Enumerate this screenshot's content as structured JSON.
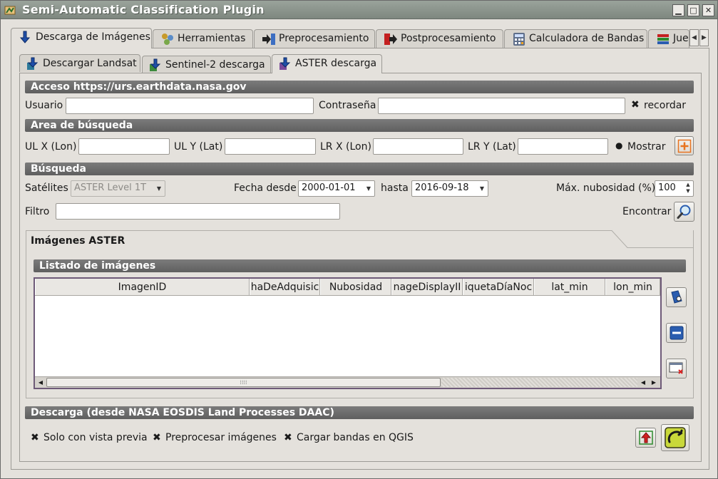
{
  "window": {
    "title": "Semi-Automatic Classification Plugin"
  },
  "main_tabs": [
    {
      "label": "Descarga de Imágenes",
      "icon": "download-arrow-icon"
    },
    {
      "label": "Herramientas",
      "icon": "tools-icon"
    },
    {
      "label": "Preprocesamiento",
      "icon": "preprocessing-icon"
    },
    {
      "label": "Postprocesamiento",
      "icon": "postprocessing-icon"
    },
    {
      "label": "Calculadora de Bandas",
      "icon": "band-calculator-icon"
    },
    {
      "label": "Jue",
      "icon": "band-set-icon"
    }
  ],
  "sub_tabs": [
    {
      "label": "Descargar Landsat"
    },
    {
      "label": "Sentinel-2 descarga"
    },
    {
      "label": "ASTER descarga"
    }
  ],
  "access": {
    "header": "Acceso https://urs.earthdata.nasa.gov",
    "user_label": "Usuario",
    "user_value": "",
    "password_label": "Contraseña",
    "password_value": "",
    "remember_label": "recordar",
    "remember_checked": true
  },
  "search_area": {
    "header": "Area de búsqueda",
    "ulx_label": "UL X (Lon)",
    "uly_label": "UL Y (Lat)",
    "lrx_label": "LR X (Lon)",
    "lry_label": "LR Y (Lat)",
    "show_label": "Mostrar",
    "show_checked": true
  },
  "search": {
    "header": "Búsqueda",
    "satellites_label": "Satélites",
    "satellite_value": "ASTER Level 1T",
    "date_from_label": "Fecha desde",
    "date_from_value": "2000-01-01",
    "date_to_label": "hasta",
    "date_to_value": "2016-09-18",
    "cloud_label": "Máx. nubosidad (%)",
    "cloud_value": "100",
    "filter_label": "Filtro",
    "filter_value": "",
    "find_label": "Encontrar"
  },
  "images_group": {
    "title": "Imágenes ASTER",
    "list_header": "Listado de imágenes",
    "columns": [
      "ImagenID",
      "haDeAdquisic",
      "Nubosidad",
      "nageDisplayII",
      "iquetaDíaNoc",
      "lat_min",
      "lon_min"
    ]
  },
  "download": {
    "header": "Descarga (desde NASA EOSDIS Land Processes DAAC)",
    "preview_only_label": "Solo con vista previa",
    "preview_only_checked": true,
    "preprocess_label": "Preprocesar imágenes",
    "preprocess_checked": true,
    "load_bands_label": "Cargar bandas en QGIS",
    "load_bands_checked": true
  },
  "colors": {
    "accent_orange": "#e8731f",
    "icon_blue": "#2a5db0",
    "section_gray": "#6c6c6c"
  }
}
